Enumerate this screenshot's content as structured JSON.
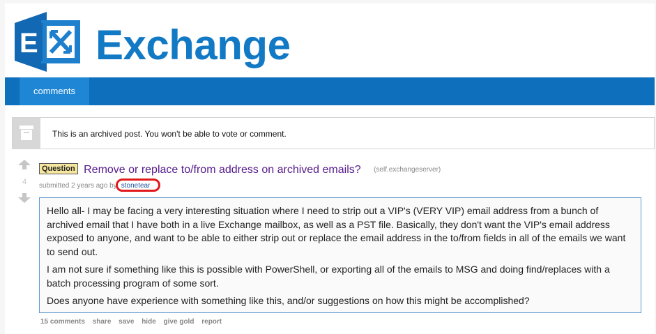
{
  "header": {
    "logo_letter": "E",
    "brand_name": "Exchange",
    "brand_color": "#1279c5"
  },
  "nav": {
    "tabs": [
      {
        "label": "comments"
      }
    ]
  },
  "notice": {
    "icon": "archive-box-icon",
    "text": "This is an archived post. You won't be able to vote or comment."
  },
  "post": {
    "score": "4",
    "flair": "Question",
    "title": "Remove or replace to/from address on archived emails?",
    "domain": "(self.exchangeserver)",
    "submitted": "submitted 2 years ago by",
    "author": "stonetear",
    "paragraphs": [
      "Hello all- I may be facing a very interesting situation where I need to strip out a VIP's (VERY VIP) email address from a bunch of archived email that I have both in a live Exchange mailbox, as well as a PST file. Basically, they don't want the VIP's email address exposed to anyone, and want to be able to either strip out or replace the email address in the to/from fields in all of the emails we want to send out.",
      "I am not sure if something like this is possible with PowerShell, or exporting all of the emails to MSG and doing find/replaces with a batch processing program of some sort.",
      "Does anyone have experience with something like this, and/or suggestions on how this might be accomplished?"
    ],
    "buttons": {
      "comments": "15 comments",
      "share": "share",
      "save": "save",
      "hide": "hide",
      "give_gold": "give gold",
      "report": "report"
    }
  }
}
